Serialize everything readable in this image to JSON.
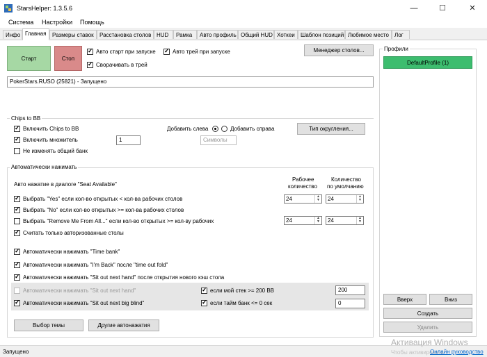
{
  "window": {
    "title": "StarsHelper: 1.3.5.6",
    "min": "—",
    "max": "☐",
    "close": "✕"
  },
  "menu": [
    "Система",
    "Настройки",
    "Помощь"
  ],
  "tabs": [
    "Инфо",
    "Главная",
    "Размеры ставок",
    "Расстановка столов",
    "HUD",
    "Рамка",
    "Авто профиль",
    "Общий HUD",
    "Хоткеи",
    "Шаблон позиций",
    "Любимое место",
    "Лог"
  ],
  "main": {
    "start": "Старт",
    "stop": "Стоп",
    "autostart": "Авто старт при запуске",
    "autotray": "Авто трей при запуске",
    "minimize_tray": "Сворачивать в трей",
    "window_manager": "Менеджер столов...",
    "status_box": "PokerStars.RUSO (25821) - Запущено"
  },
  "chips": {
    "title": "Chips to BB",
    "enable": "Включить Chips to BB",
    "multiplier": "Включить множитель",
    "multiplier_value": "1",
    "no_change_bank": "Не изменять общий банк",
    "add_left": "Добавить слева",
    "add_right": "Добавить справа",
    "symbols_placeholder": "Символы",
    "rounding": "Тип округления..."
  },
  "auto": {
    "title": "Автоматически нажимать",
    "seat_available": "Авто нажатие в диалоге \"Seat Available\"",
    "col_working_1": "Рабочее",
    "col_working_2": "количество",
    "col_default_1": "Количество",
    "col_default_2": "по умолчанию",
    "yes_label": "Выбрать \"Yes\" если кол-во открытых < кол-ва рабочих столов",
    "no_label": "Выбрать \"No\" если кол-во открытых >= кол-ва рабочих столов",
    "remove_label": "Выбрать \"Remove Me From All...\" если кол-во открытых >= кол-ву рабочих",
    "only_authorized": "Считать только авторизованные столы",
    "yes_working": "24",
    "yes_default": "24",
    "remove_working": "24",
    "remove_default": "24",
    "time_bank": "Автоматически нажимать \"Time bank\"",
    "im_back": "Автоматически нажимать \"I'm Back\" после \"time out fold\"",
    "sit_out_next_hand_new": "Автоматически нажимать \"Sit out next hand\" после открытия нового кэш стола",
    "sit_out_next_hand": "Автоматически нажимать \"Sit out next hand\"",
    "sit_out_big_blind": "Автоматически нажимать \"Sit out next big blind\"",
    "stack_cond": "если мой стек >= 200 BB",
    "stack_value": "200",
    "timebank_cond": "если тайм банк <= 0 сек",
    "timebank_value": "0"
  },
  "bottom": {
    "theme": "Выбор темы",
    "other": "Другие автонажатия"
  },
  "profiles": {
    "title": "Профили",
    "items": [
      "DefaultProfile (1)"
    ],
    "up": "Вверх",
    "down": "Вниз",
    "create": "Создать",
    "delete": "Удалить"
  },
  "status": "Запущено",
  "watermark": {
    "line1": "Активация Windows",
    "line2": "Чтобы активировать",
    "manual": "Онлайн руководство"
  },
  "colors": {
    "start": "#a6d8a4",
    "stop": "#d98a8a",
    "profile": "#3dbd6f",
    "link": "#0066cc"
  }
}
